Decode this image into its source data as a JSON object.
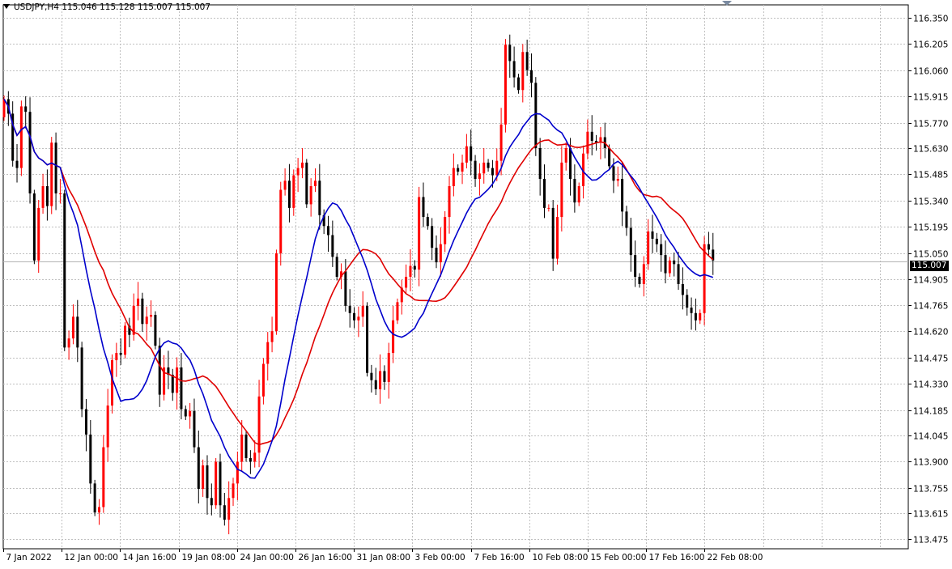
{
  "header": {
    "symbol": "USDJPY,H4",
    "open": "115.046",
    "high": "115.128",
    "low": "115.007",
    "close": "115.007"
  },
  "current_price_label": "115.007",
  "colors": {
    "bull": "#ff0000",
    "bear": "#000000",
    "ma_fast": "#0000cc",
    "ma_slow": "#e00000",
    "grid": "#c0c0c0",
    "price_line": "#b4b4b4"
  },
  "chart_data": {
    "type": "candlestick",
    "title": "USDJPY,H4",
    "ylim": [
      113.42,
      116.42
    ],
    "y_ticks": [
      "116.350",
      "116.205",
      "116.060",
      "115.915",
      "115.770",
      "115.630",
      "115.485",
      "115.340",
      "115.195",
      "115.050",
      "114.905",
      "114.765",
      "114.620",
      "114.475",
      "114.330",
      "114.185",
      "114.045",
      "113.900",
      "113.755",
      "113.615",
      "113.475"
    ],
    "x_ticks": [
      "7 Jan 2022",
      "12 Jan 00:00",
      "14 Jan 16:00",
      "19 Jan 08:00",
      "24 Jan 00:00",
      "26 Jan 16:00",
      "31 Jan 08:00",
      "3 Feb 00:00",
      "7 Feb 16:00",
      "10 Feb 08:00",
      "15 Feb 00:00",
      "17 Feb 16:00",
      "22 Feb 08:00"
    ],
    "current_price": 115.007,
    "close": [
      115.9,
      115.82,
      115.56,
      115.52,
      115.86,
      115.83,
      115.38,
      115.01,
      115.3,
      115.42,
      115.31,
      115.66,
      115.38,
      115.38,
      114.53,
      114.58,
      114.7,
      114.53,
      114.19,
      114.05,
      113.78,
      113.62,
      113.65,
      113.98,
      114.21,
      114.46,
      114.5,
      114.49,
      114.65,
      114.6,
      114.76,
      114.8,
      114.66,
      114.7,
      114.71,
      114.54,
      114.27,
      114.42,
      114.38,
      114.28,
      114.42,
      114.19,
      114.15,
      114.18,
      113.98,
      113.75,
      113.88,
      113.7,
      113.66,
      113.9,
      113.66,
      113.58,
      113.7,
      113.78,
      113.9,
      114.05,
      113.92,
      113.9,
      113.95,
      114.26,
      114.44,
      114.56,
      114.62,
      115.05,
      115.4,
      115.45,
      115.3,
      115.48,
      115.52,
      115.55,
      115.32,
      115.42,
      115.45,
      115.26,
      115.2,
      115.15,
      115.03,
      114.92,
      114.95,
      114.76,
      114.72,
      114.68,
      114.7,
      114.76,
      114.39,
      114.35,
      114.3,
      114.4,
      114.34,
      114.5,
      114.68,
      114.78,
      114.86,
      114.92,
      114.98,
      114.96,
      115.36,
      115.25,
      115.2,
      115.08,
      115.0,
      115.1,
      115.25,
      115.42,
      115.52,
      115.5,
      115.55,
      115.64,
      115.56,
      115.46,
      115.49,
      115.55,
      115.52,
      115.48,
      115.56,
      115.76,
      116.2,
      116.11,
      116.02,
      115.95,
      116.16,
      116.06,
      115.99,
      115.63,
      115.46,
      115.3,
      115.3,
      115.02,
      115.25,
      115.55,
      115.63,
      115.46,
      115.33,
      115.42,
      115.6,
      115.72,
      115.67,
      115.66,
      115.69,
      115.63,
      115.53,
      115.45,
      115.46,
      115.28,
      115.19,
      115.04,
      114.92,
      114.88,
      114.99,
      115.17,
      115.13,
      115.1,
      115.04,
      114.94,
      115.01,
      114.99,
      114.88,
      114.82,
      114.75,
      114.72,
      114.68,
      114.72,
      115.1,
      115.07,
      115.01
    ]
  }
}
